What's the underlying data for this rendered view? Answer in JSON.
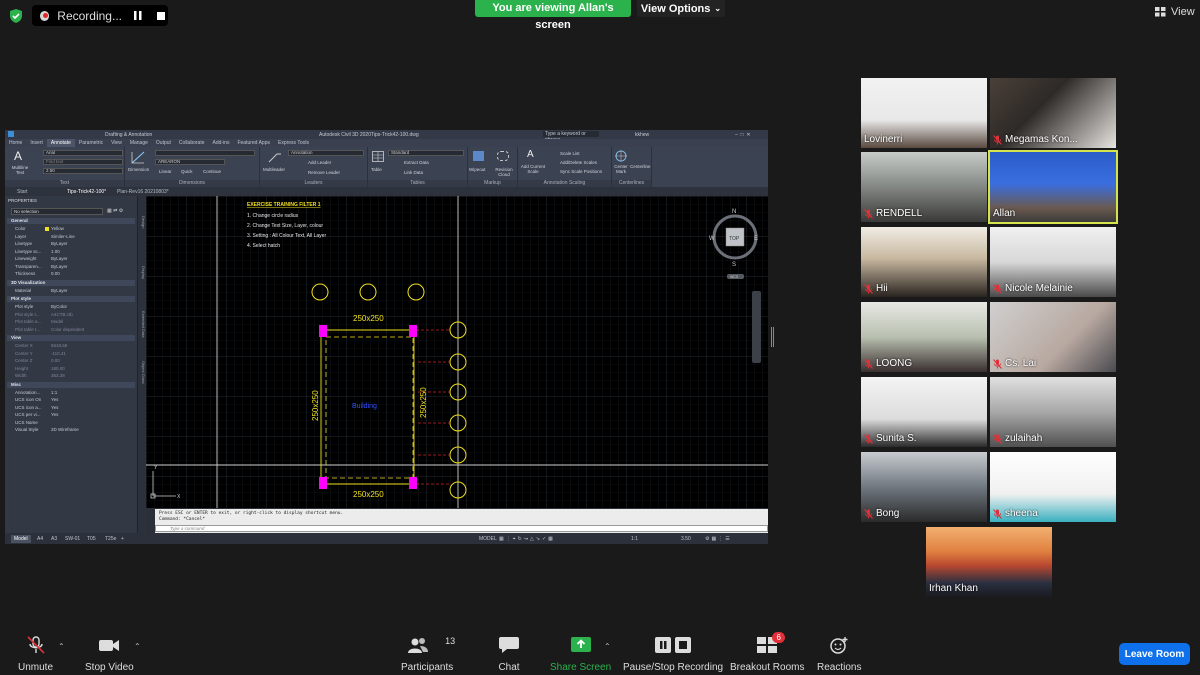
{
  "topbar": {
    "recording_label": "Recording...",
    "viewing_banner": "You are viewing Allan's screen",
    "view_options": "View Options",
    "view_label": "View",
    "accent_green": "#2bb24c"
  },
  "cad": {
    "app_title": "Autodesk Civil 3D 2020",
    "drawing_name": "Tips-Trick42-100.dwg",
    "search_placeholder": "Type a keyword or phrase",
    "user": "kkhew",
    "workspace": "Drafting & Annotation",
    "ribbon_tabs": [
      "Home",
      "Insert",
      "Annotate",
      "Parametric",
      "View",
      "Manage",
      "Output",
      "Collaborate",
      "Add-ins",
      "Featured Apps",
      "Express Tools"
    ],
    "active_ribbon_tab": "Annotate",
    "ribbon": {
      "text_panel": "Text",
      "multiline_text": "Multiline Text",
      "font_value": "Arial",
      "find_placeholder": "Find text",
      "height_value": "2.50",
      "dimension_button": "Dimension",
      "dim_style": "AREARON",
      "linear": "Linear",
      "quick": "Quick",
      "continue": "Continue",
      "dimensions_panel": "Dimensions",
      "multileader": "Multileader",
      "leader_style": "Annotation",
      "add_leader": "Add Leader",
      "remove_leader": "Remove Leader",
      "leaders_panel": "Leaders",
      "table": "Table",
      "table_style": "Standard",
      "extract_data": "Extract Data",
      "link_data": "Link Data",
      "tables_panel": "Tables",
      "wipeout": "Wipeout",
      "revision_cloud": "Revision Cloud",
      "markup_panel": "Markup",
      "add_current_scale": "Add Current Scale",
      "scale_list": "Scale List",
      "add_delete_scales": "Add/Delete Scales",
      "sync_scale_positions": "Sync Scale Positions",
      "annotation_scaling_panel": "Annotation Scaling",
      "center_mark": "Center Mark",
      "centerline": "Centerline",
      "centerlines_panel": "Centerlines"
    },
    "file_tabs": [
      "Start",
      "Tips-Trick42-100*",
      "Plan-Rev16 20210803*"
    ],
    "properties": {
      "title": "PROPERTIES",
      "selection": "No selection",
      "sections": [
        {
          "name": "General",
          "rows": [
            [
              "Color",
              "Yellow"
            ],
            [
              "Layer",
              "Similer-Line"
            ],
            [
              "Linetype",
              "ByLayer"
            ],
            [
              "Linetype sc...",
              "1.00"
            ],
            [
              "Lineweight",
              "ByLayer"
            ],
            [
              "Transparen...",
              "ByLayer"
            ],
            [
              "Thickness",
              "0.00"
            ]
          ]
        },
        {
          "name": "3D Visualization",
          "rows": [
            [
              "Material",
              "ByLayer"
            ]
          ]
        },
        {
          "name": "Plot style",
          "rows": [
            [
              "Plot style",
              "ByColor"
            ],
            [
              "Plot style t...",
              "A4CTB.ctb"
            ],
            [
              "Plot table a...",
              "Model"
            ],
            [
              "Plot table t...",
              "Color dependent"
            ]
          ]
        },
        {
          "name": "View",
          "rows": [
            [
              "Center X",
              "5618.68"
            ],
            [
              "Center Y",
              "-110.41"
            ],
            [
              "Center Z",
              "0.00"
            ],
            [
              "Height",
              "180.00"
            ],
            [
              "Width",
              "363.28"
            ]
          ]
        },
        {
          "name": "Misc",
          "rows": [
            [
              "Annotation...",
              "1:1"
            ],
            [
              "UCS icon On",
              "Yes"
            ],
            [
              "UCS icon a...",
              "Yes"
            ],
            [
              "UCS per vi...",
              "Yes"
            ],
            [
              "UCS Name",
              ""
            ],
            [
              "Visual Style",
              "2D Wireframe"
            ]
          ]
        }
      ]
    },
    "side_tabs": [
      "Design",
      "Display",
      "Extended Data",
      "Object Class"
    ],
    "exercise": {
      "title": "EXERCISE TRAINING FILTER 1",
      "steps": [
        "1.    Change circle radius",
        "2.    Change Text Size, Layer, colour",
        "3.    Setting :  All Colour Text,  All Layer",
        "4.    Select hatch"
      ]
    },
    "drawing": {
      "dim_top": "250x250",
      "dim_bottom": "250x250",
      "dim_left": "250x250",
      "dim_right": "250x250",
      "building_label": "Building"
    },
    "viewcube": {
      "n": "N",
      "s": "S",
      "e": "E",
      "w": "W",
      "top": "TOP",
      "wcs": "WCS"
    },
    "command_lines": [
      "Press ESC or ENTER to exit, or right-click to display shortcut menu.",
      "Command: *Cancel*"
    ],
    "command_placeholder": "Type a command",
    "layout_tabs": [
      "Model",
      "A4",
      "A3",
      "SW-01",
      "T05",
      "T25e"
    ],
    "status_model": "MODEL",
    "status_scale": "1:1",
    "status_value": "3.50"
  },
  "participants_tiles": [
    {
      "name": "Lovinerri",
      "muted": false
    },
    {
      "name": "Megamas Kon...",
      "muted": true
    },
    {
      "name": "RENDELL",
      "muted": true
    },
    {
      "name": "Allan",
      "muted": false,
      "active": true
    },
    {
      "name": "Hii",
      "muted": true
    },
    {
      "name": "Nicole Melainie",
      "muted": true
    },
    {
      "name": "LOONG",
      "muted": true
    },
    {
      "name": "Cs. Lai",
      "muted": true
    },
    {
      "name": "Sunita S.",
      "muted": true
    },
    {
      "name": "zulaihah",
      "muted": true
    },
    {
      "name": "Bong",
      "muted": true
    },
    {
      "name": "sheena",
      "muted": true
    },
    {
      "name": "Irhan Khan",
      "muted": false
    }
  ],
  "toolbar": {
    "unmute": "Unmute",
    "stop_video": "Stop Video",
    "participants": "Participants",
    "participants_count": "13",
    "chat": "Chat",
    "share_screen": "Share Screen",
    "pause_stop_recording": "Pause/Stop Recording",
    "breakout_rooms": "Breakout Rooms",
    "breakout_badge": "6",
    "reactions": "Reactions",
    "leave_room": "Leave Room",
    "leave_color": "#0e71eb"
  }
}
